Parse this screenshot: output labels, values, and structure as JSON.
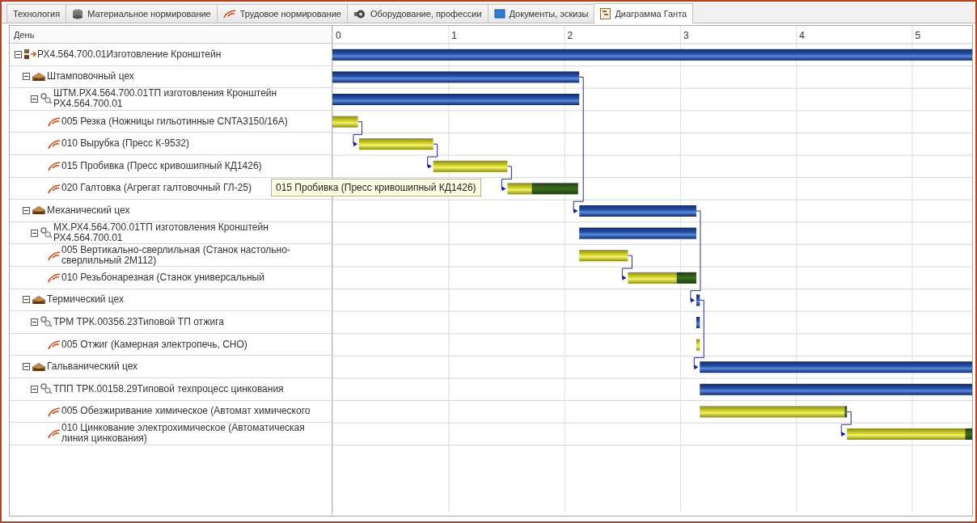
{
  "tabs": [
    {
      "label": "Технология",
      "selected": false
    },
    {
      "label": "Материальное нормирование",
      "selected": false
    },
    {
      "label": "Трудовое нормирование",
      "selected": false
    },
    {
      "label": "Оборудование, профессии",
      "selected": false
    },
    {
      "label": "Документы, эскизы",
      "selected": false
    },
    {
      "label": "Диаграмма Ганта",
      "selected": true
    }
  ],
  "tree_header": "День",
  "tree": [
    {
      "kind": "product",
      "label": "РХ4.564.700.01Изготовление Кронштейн",
      "expanded": true,
      "children": [
        {
          "kind": "shop",
          "label": "Штамповочный цех",
          "expanded": true,
          "children": [
            {
              "kind": "process",
              "label": "ШТМ.РХ4.564.700.01ТП изготовления Кронштейн РХ4.564.700.01",
              "expanded": true,
              "children": [
                {
                  "kind": "operation",
                  "label": "005 Резка (Ножницы гильотинные CNTA3150/16A)"
                },
                {
                  "kind": "operation",
                  "label": "010 Вырубка (Пресс К-9532)"
                },
                {
                  "kind": "operation",
                  "label": "015 Пробивка (Пресс кривошипный КД1426)"
                },
                {
                  "kind": "operation",
                  "label": "020 Галтовка (Агрегат галтовочный ГЛ-25)"
                }
              ]
            }
          ]
        },
        {
          "kind": "shop",
          "label": "Механический цех",
          "expanded": true,
          "children": [
            {
              "kind": "process",
              "label": "МХ.РХ4.564.700.01ТП изготовления Кронштейн РХ4.564.700.01",
              "expanded": true,
              "children": [
                {
                  "kind": "operation",
                  "label": "005 Вертикально-сверлильная (Станок настольно-сверлильный 2М112)"
                },
                {
                  "kind": "operation",
                  "label": "010 Резьбонарезная (Станок универсальный"
                }
              ]
            }
          ]
        },
        {
          "kind": "shop",
          "label": "Термический цех",
          "expanded": true,
          "children": [
            {
              "kind": "process",
              "label": "ТРМ ТРК.00356.23Типовой ТП отжига",
              "expanded": true,
              "children": [
                {
                  "kind": "operation",
                  "label": "005 Отжиг (Камерная электропечь, СНО)"
                }
              ]
            }
          ]
        },
        {
          "kind": "shop",
          "label": "Гальванический цех",
          "expanded": true,
          "children": [
            {
              "kind": "process",
              "label": "ТПП ТРК.00158.29Типовой техпроцесс цинкования",
              "expanded": true,
              "children": [
                {
                  "kind": "operation",
                  "label": "005 Обезжиривание химическое (Автомат химического"
                },
                {
                  "kind": "operation",
                  "label": "010 Цинкование электрохимическое (Автоматическая линия цинкования)"
                }
              ]
            }
          ]
        }
      ]
    }
  ],
  "tooltip": {
    "text": "015 Пробивка (Пресс кривошипный КД1426)"
  },
  "timeline": {
    "day_labels": [
      "0",
      "1",
      "2",
      "3",
      "4",
      "5"
    ]
  }
}
